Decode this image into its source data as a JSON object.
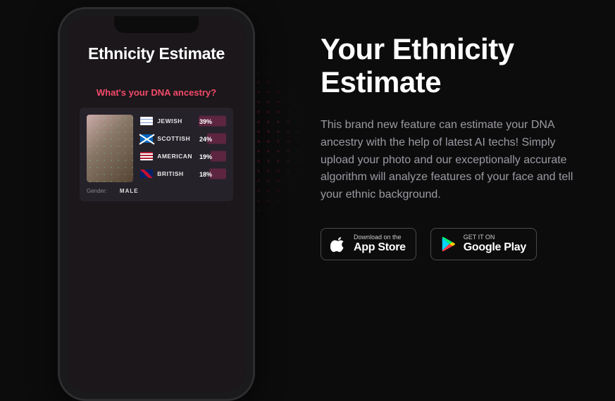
{
  "phone": {
    "title": "Ethnicity Estimate",
    "subtitle": "What's your DNA ancestry?",
    "gender_label": "Gender:",
    "gender_value": "MALE",
    "results": [
      {
        "flag": "il",
        "name": "JEWISH",
        "pct": "39%",
        "bar": 39
      },
      {
        "flag": "sc",
        "name": "SCOTTISH",
        "pct": "24%",
        "bar": 27
      },
      {
        "flag": "us",
        "name": "AMERICAN",
        "pct": "19%",
        "bar": 22
      },
      {
        "flag": "gb",
        "name": "BRITISH",
        "pct": "18%",
        "bar": 24
      }
    ]
  },
  "headline": "Your Ethnicity Estimate",
  "description": "This brand new feature can estimate your DNA ancestry with the help of latest AI techs! Simply upload your photo and our exceptionally accurate algorithm will analyze features of your face and tell your ethnic background.",
  "stores": {
    "apple": {
      "small": "Download on the",
      "big": "App Store"
    },
    "google": {
      "small": "GET IT ON",
      "big": "Google Play"
    }
  }
}
